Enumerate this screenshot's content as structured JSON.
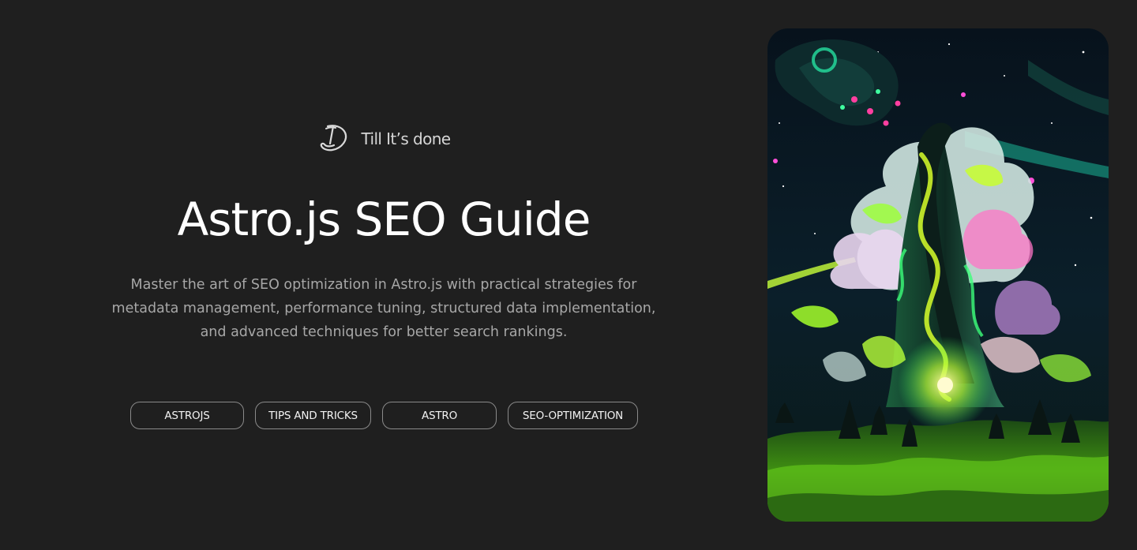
{
  "brand": {
    "name": "Till It’s done",
    "logo_icon": "td-monogram-icon"
  },
  "hero": {
    "title": "Astro.js SEO Guide",
    "description": "Master the art of SEO optimization in Astro.js with practical strategies for metadata management, performance tuning, structured data implementation, and advanced techniques for better search rankings."
  },
  "tags": [
    {
      "label": "ASTROJS"
    },
    {
      "label": "TIPS AND TRICKS"
    },
    {
      "label": "ASTRO"
    },
    {
      "label": "SEO-OPTIMIZATION"
    }
  ],
  "cover_image": {
    "subject": "psychedelic cosmic swirling tower over neon green landscape"
  },
  "colors": {
    "background": "#1f1f1f",
    "title": "#ffffff",
    "description": "#a7a7a7",
    "tag_border": "#8a8a8a"
  }
}
